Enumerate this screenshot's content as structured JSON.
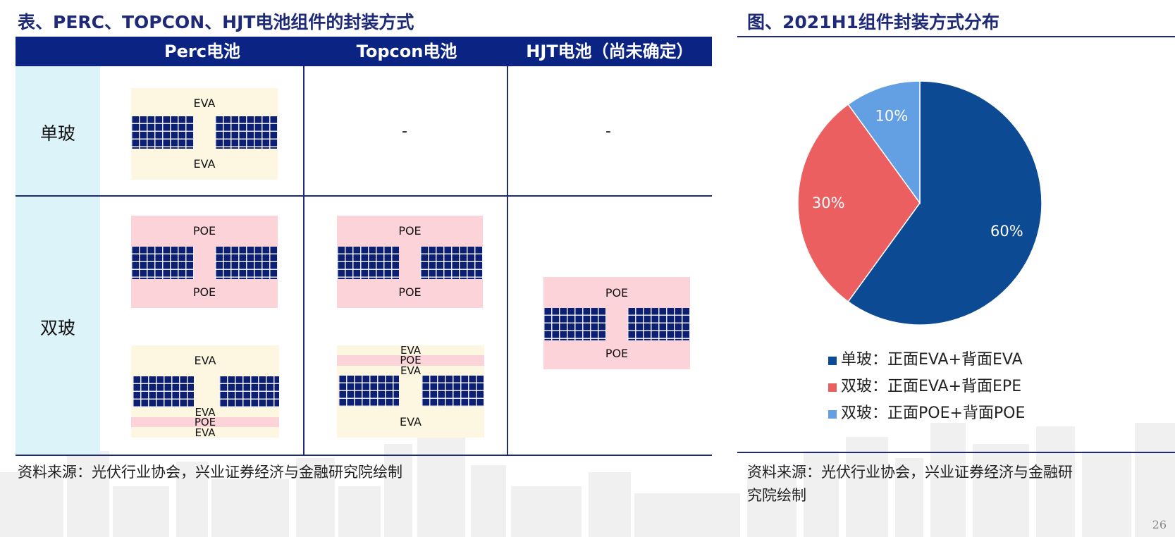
{
  "left_title": "表、PERC、TOPCON、HJT电池组件的封装方式",
  "right_title": "图、2021H1组件封装方式分布",
  "table": {
    "columns": [
      "Perc电池",
      "Topcon电池",
      "HJT电池（尚未确定）"
    ],
    "rows": [
      "单玻",
      "双玻"
    ],
    "empty_cell": "-",
    "single_glass": {
      "perc": {
        "top": "EVA",
        "bottom": "EVA"
      }
    },
    "double_glass": {
      "perc_a": {
        "top": "POE",
        "bottom": "POE"
      },
      "perc_b": {
        "top": "EVA",
        "bottom": [
          "EVA",
          "POE",
          "EVA"
        ]
      },
      "topcon_a": {
        "top": "POE",
        "bottom": "POE"
      },
      "topcon_b": {
        "top": [
          "EVA",
          "POE",
          "EVA"
        ],
        "bottom": "EVA"
      },
      "hjt": {
        "top": "POE",
        "bottom": "POE"
      }
    }
  },
  "colors": {
    "navy": "#0b2383",
    "eva": "#fdf6e0",
    "poe": "#fdd3da",
    "row_header": "#ddf3fa",
    "cell": "#0d1f73"
  },
  "chart_data": {
    "type": "pie",
    "title": "图、2021H1组件封装方式分布",
    "start_angle": "12 o'clock, clockwise",
    "slices": [
      {
        "label": "单玻：正面EVA+背面EVA",
        "value": 60,
        "display": "60%",
        "color": "#0c4a94"
      },
      {
        "label": "双玻：正面EVA+背面EPE",
        "value": 30,
        "display": "30%",
        "color": "#ec5f61"
      },
      {
        "label": "双玻：正面POE+背面POE",
        "value": 10,
        "display": "10%",
        "color": "#62a0e3"
      }
    ],
    "legend_position": "bottom"
  },
  "source_left": "资料来源：光伏行业协会，兴业证券经济与金融研究院绘制",
  "source_right_line1": "资料来源：光伏行业协会，兴业证券经济与金融研",
  "source_right_line2": "究院绘制",
  "page_number": "26"
}
